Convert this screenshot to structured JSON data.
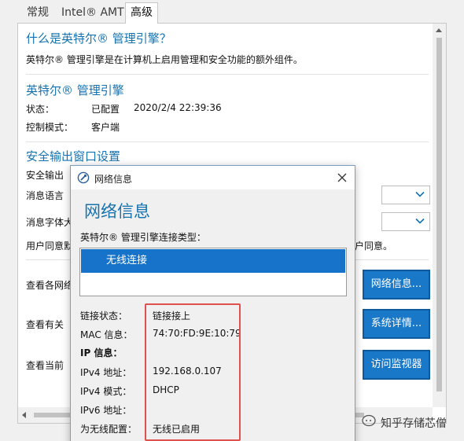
{
  "tabs": [
    "常规",
    "Intel® AMT",
    "高级"
  ],
  "intro": {
    "title": "什么是英特尔® 管理引擎？",
    "description": "英特尔® 管理引擎是在计算机上启用管理和安全功能的额外组件。"
  },
  "engine": {
    "title": "英特尔® 管理引擎",
    "status_label": "状态：",
    "status_value": "已配置",
    "status_time": "2020/2/4 22:39:36",
    "control_mode_label": "控制模式：",
    "control_mode_value": "客户端"
  },
  "secure_output": {
    "title": "安全输出窗口设置",
    "line1": "安全输出",
    "message_language": "消息语言",
    "message_font": "消息字体大",
    "consent_left": "用户同意默",
    "consent_right": "户同意。"
  },
  "actions": [
    {
      "label": "查看各网络",
      "button": "网络信息..."
    },
    {
      "label": "查看有关",
      "button": "系统详情..."
    },
    {
      "label": "查看当前",
      "button": "访问监视器"
    }
  ],
  "dialog": {
    "title": "网络信息",
    "heading": "网络信息",
    "connection_type_label": "英特尔® 管理引擎连接类型：",
    "connection_option": "无线连接",
    "fields": [
      {
        "label": "链接状态：",
        "value": "链接接上"
      },
      {
        "label": "MAC 信息：",
        "value": "74:70:FD:9E:10:79"
      },
      {
        "label": "IP 信息：",
        "value": ""
      },
      {
        "label": "IPv4 地址：",
        "value": "192.168.0.107"
      },
      {
        "label": "IPv4 模式：",
        "value": "DHCP"
      },
      {
        "label": "IPv6 地址：",
        "value": ""
      },
      {
        "label": "为无线配置：",
        "value": "无线已启用"
      }
    ]
  },
  "watermark": "知乎存储芯僧",
  "colors": {
    "accent": "#1673b0",
    "button": "#1978c8",
    "highlight_box": "#e0504c"
  }
}
